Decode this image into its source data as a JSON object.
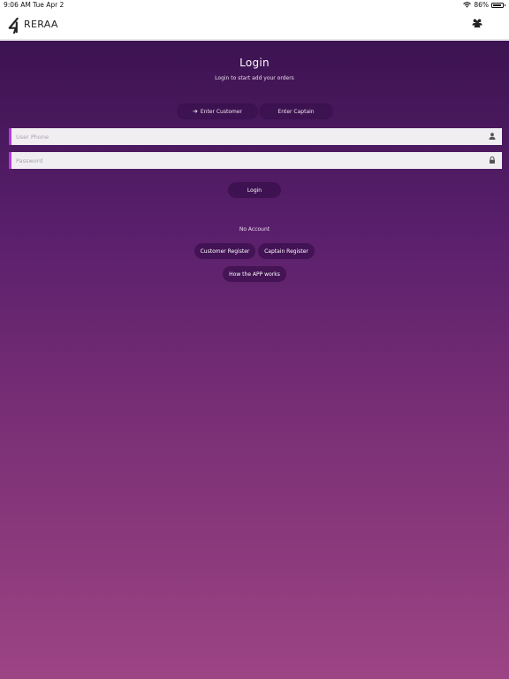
{
  "status_bar": {
    "time": "9:06 AM",
    "date": "Tue Apr 2",
    "battery": "86%",
    "battery_level": 0.86,
    "wifi_icon": "wifi-icon",
    "battery_icon": "battery-icon"
  },
  "nav": {
    "brand": "RERAA",
    "logo_icon": "logo-icon",
    "users_icon": "users-icon"
  },
  "login": {
    "title": "Login",
    "subtitle": "Login to start add your orders",
    "tabs": [
      {
        "label": "Enter Customer",
        "icon": "arrow-right-icon",
        "selected": true
      },
      {
        "label": "Enter Captain",
        "selected": false
      }
    ],
    "phone_placeholder": "User Phone",
    "password_placeholder": "Password",
    "phone_icon": "user-icon",
    "password_icon": "lock-icon",
    "login_button": "Login",
    "no_account": "No Account",
    "customer_register": "Customer Register",
    "captain_register": "Captain Register",
    "how_app_works": "How the APP works"
  },
  "colors": {
    "gradient_top": "#3c1351",
    "gradient_bottom": "#9c4484",
    "field_accent": "#b23bd6",
    "nav_background": "#ffffff"
  }
}
